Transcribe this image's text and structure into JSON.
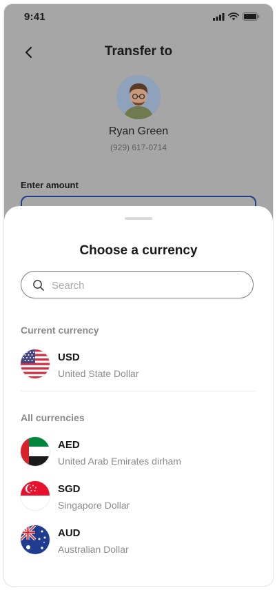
{
  "status_bar": {
    "time": "9:41"
  },
  "header": {
    "title": "Transfer to"
  },
  "recipient": {
    "name": "Ryan Green",
    "phone": "(929) 617-0714"
  },
  "amount": {
    "label": "Enter amount"
  },
  "sheet": {
    "title": "Choose a currency",
    "search_placeholder": "Search",
    "current_label": "Current currency",
    "all_label": "All currencies",
    "current": {
      "code": "USD",
      "name": "United State Dollar"
    },
    "currencies": [
      {
        "code": "AED",
        "name": "United Arab Emirates dirham"
      },
      {
        "code": "SGD",
        "name": "Singapore Dollar"
      },
      {
        "code": "AUD",
        "name": "Australian Dollar"
      }
    ]
  },
  "colors": {
    "accent": "#1f3f86",
    "overlay": "#a6a6a6",
    "muted_text": "#8c8c8c"
  }
}
